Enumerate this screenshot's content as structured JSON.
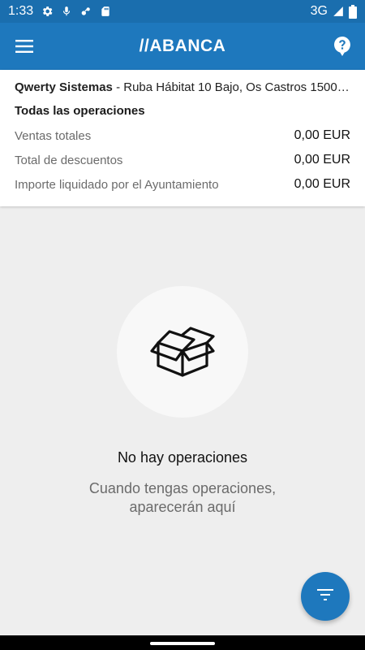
{
  "status_bar": {
    "time": "1:33",
    "network": "3G",
    "icons": [
      "settings-icon",
      "mic-icon",
      "sync-icon",
      "sd-card-icon",
      "signal-icon",
      "battery-icon"
    ]
  },
  "toolbar": {
    "logo": "//ABANCA",
    "menu_icon": "hamburger-menu-icon",
    "help_icon": "help-icon",
    "bg_color": "#1e78bd"
  },
  "summary": {
    "merchant_name": "Qwerty Sistemas",
    "merchant_address": " - Ruba Hábitat 10 Bajo, Os Castros 15001...",
    "section_title": "Todas las operaciones",
    "rows": [
      {
        "label": "Ventas totales",
        "value": "0,00 EUR"
      },
      {
        "label": "Total de descuentos",
        "value": "0,00 EUR"
      },
      {
        "label": "Importe liquidado por el Ayuntamiento",
        "value": "0,00 EUR"
      }
    ]
  },
  "empty_state": {
    "icon": "open-box-icon",
    "title": "No hay operaciones",
    "subtitle_line1": "Cuando tengas operaciones,",
    "subtitle_line2": "aparecerán aquí"
  },
  "fab": {
    "icon": "filter-icon"
  }
}
